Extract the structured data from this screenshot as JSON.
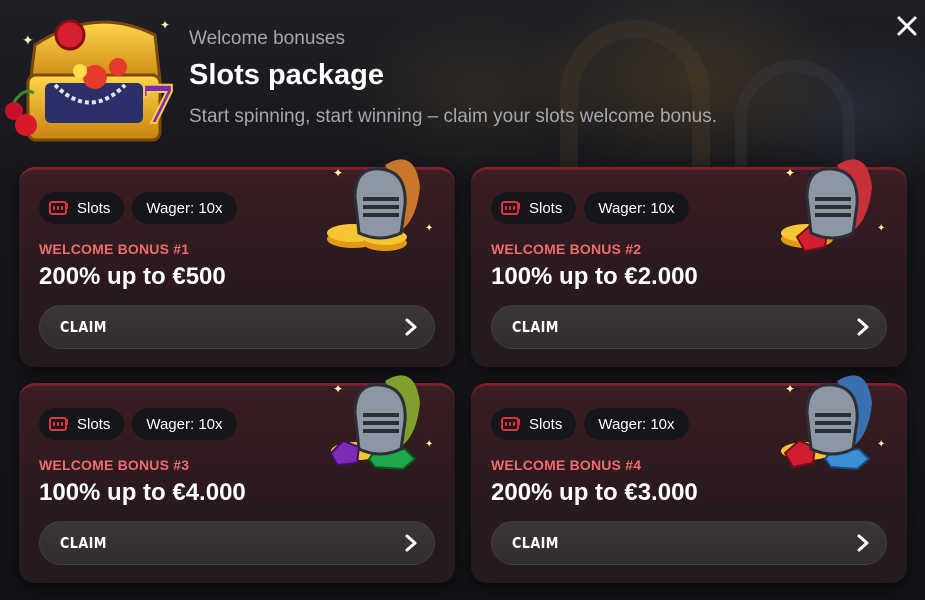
{
  "header": {
    "eyebrow": "Welcome bonuses",
    "title": "Slots package",
    "subtitle": "Start spinning, start winning – claim your slots welcome bonus."
  },
  "close_icon": "close-icon",
  "cards": [
    {
      "category_chip": "Slots",
      "wager_chip": "Wager: 10x",
      "label": "WELCOME BONUS #1",
      "amount": "200% up to €500",
      "claim_label": "CLAIM",
      "plume_color": "#c8762a",
      "gems": [
        "gold-coins"
      ]
    },
    {
      "category_chip": "Slots",
      "wager_chip": "Wager: 10x",
      "label": "WELCOME BONUS #2",
      "amount": "100% up to €2.000",
      "claim_label": "CLAIM",
      "plume_color": "#c8303a",
      "gems": [
        "red-gem"
      ]
    },
    {
      "category_chip": "Slots",
      "wager_chip": "Wager: 10x",
      "label": "WELCOME BONUS #3",
      "amount": "100% up to €4.000",
      "claim_label": "CLAIM",
      "plume_color": "#7fa02c",
      "gems": [
        "purple-gem",
        "green-gem"
      ]
    },
    {
      "category_chip": "Slots",
      "wager_chip": "Wager: 10x",
      "label": "WELCOME BONUS #4",
      "amount": "200% up to €3.000",
      "claim_label": "CLAIM",
      "plume_color": "#3a6fb0",
      "gems": [
        "red-gem",
        "blue-gem"
      ]
    }
  ],
  "colors": {
    "accent_label": "#f06b6d",
    "card_border": "#8a1d28",
    "chip_bg": "#15161b",
    "claim_bg": "#3b3638"
  }
}
